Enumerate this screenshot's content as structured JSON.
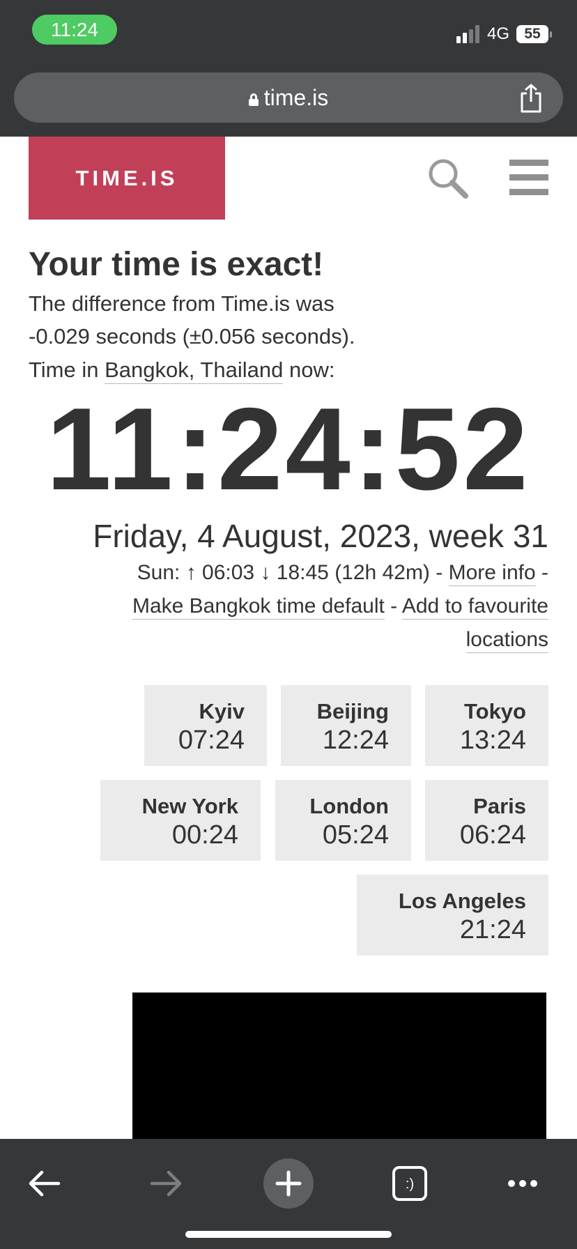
{
  "status_bar": {
    "time": "11:24",
    "network": "4G",
    "battery": "55"
  },
  "browser": {
    "url": "time.is"
  },
  "site": {
    "logo": "TIME.IS"
  },
  "content": {
    "headline": "Your time is exact!",
    "difference_line1": "The difference from Time.is was",
    "difference_line2": "-0.029 seconds (±0.056 seconds).",
    "time_in_prefix": "Time in",
    "location_link": "Bangkok, Thailand",
    "time_in_suffix": "now:",
    "clock": "11:24:52",
    "date": "Friday, 4 August, 2023, week 31",
    "sun_text": "Sun: ↑ 06:03 ↓ 18:45 (12h 42m) -",
    "more_info": "More info",
    "separator": "-",
    "make_default": "Make Bangkok time default",
    "add_favourite_line1": "Add to favourite",
    "add_favourite_line2": "locations"
  },
  "cities": [
    {
      "name": "Kyiv",
      "time": "07:24"
    },
    {
      "name": "Beijing",
      "time": "12:24"
    },
    {
      "name": "Tokyo",
      "time": "13:24"
    },
    {
      "name": "New York",
      "time": "00:24"
    },
    {
      "name": "London",
      "time": "05:24"
    },
    {
      "name": "Paris",
      "time": "06:24"
    },
    {
      "name": "Los Angeles",
      "time": "21:24"
    }
  ],
  "toolbar": {
    "back": "arrow-left-icon",
    "forward": "arrow-right-icon",
    "new_tab": "plus-icon",
    "tabs": ":)",
    "more": "more-dots-icon"
  },
  "colors": {
    "chrome": "#363739",
    "url_bar": "#5d5f62",
    "logo": "#c23f58",
    "status_pill": "#4ecb62",
    "tile": "#ebebeb"
  }
}
